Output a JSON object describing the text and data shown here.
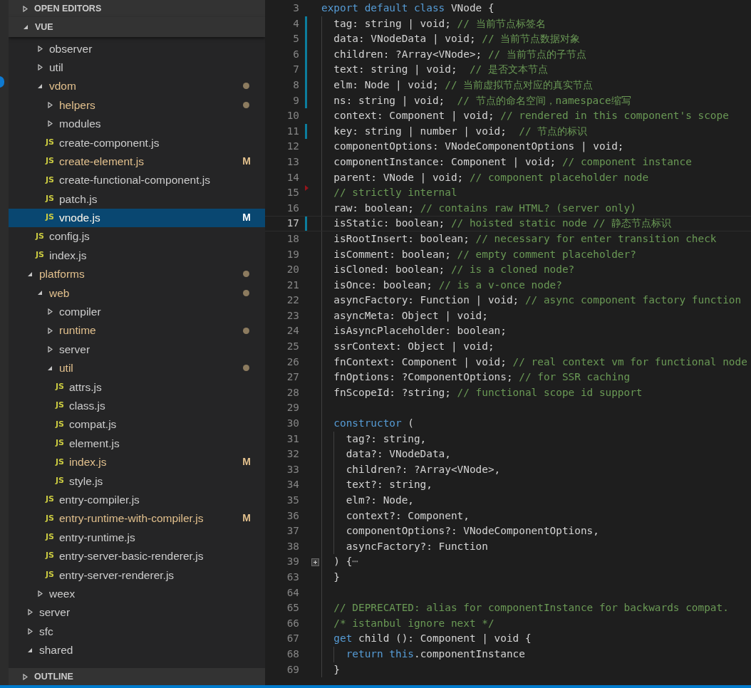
{
  "activity_bar": {
    "badge": true
  },
  "sidebar": {
    "sections": [
      {
        "title": "OPEN EDITORS",
        "expanded": false
      },
      {
        "title": "VUE",
        "expanded": true
      }
    ],
    "tree": [
      {
        "children": [
          {
            "label": "observer",
            "kind": "folder",
            "expanded": false,
            "modified": false,
            "selected": false
          },
          {
            "label": "util",
            "kind": "folder",
            "expanded": false,
            "modified": false,
            "selected": false
          },
          {
            "label": "vdom",
            "kind": "folder",
            "expanded": true,
            "modified": true,
            "selected": false,
            "children": [
              {
                "label": "helpers",
                "kind": "folder",
                "expanded": false,
                "modified": true,
                "selected": false
              },
              {
                "label": "modules",
                "kind": "folder",
                "expanded": false,
                "modified": false,
                "selected": false
              },
              {
                "label": "create-component.js",
                "kind": "file",
                "icon": "JS",
                "modified": false,
                "selected": false
              },
              {
                "label": "create-element.js",
                "kind": "file",
                "icon": "JS",
                "modified": true,
                "badge": "M",
                "selected": false
              },
              {
                "label": "create-functional-component.js",
                "kind": "file",
                "icon": "JS",
                "modified": false,
                "selected": false
              },
              {
                "label": "patch.js",
                "kind": "file",
                "icon": "JS",
                "modified": false,
                "selected": false
              },
              {
                "label": "vnode.js",
                "kind": "file",
                "icon": "JS",
                "modified": true,
                "badge": "M",
                "selected": true
              }
            ]
          },
          {
            "label": "config.js",
            "kind": "file",
            "icon": "JS",
            "modified": false,
            "selected": false
          },
          {
            "label": "index.js",
            "kind": "file",
            "icon": "JS",
            "modified": false,
            "selected": false
          }
        ]
      },
      {
        "label": "platforms",
        "kind": "folder",
        "expanded": true,
        "modified": true,
        "selected": false,
        "children": [
          {
            "label": "web",
            "kind": "folder",
            "expanded": true,
            "modified": true,
            "selected": false,
            "children": [
              {
                "label": "compiler",
                "kind": "folder",
                "expanded": false,
                "modified": false,
                "selected": false
              },
              {
                "label": "runtime",
                "kind": "folder",
                "expanded": false,
                "modified": true,
                "selected": false
              },
              {
                "label": "server",
                "kind": "folder",
                "expanded": false,
                "modified": false,
                "selected": false
              },
              {
                "label": "util",
                "kind": "folder",
                "expanded": true,
                "modified": true,
                "selected": false,
                "children": [
                  {
                    "label": "attrs.js",
                    "kind": "file",
                    "icon": "JS",
                    "modified": false,
                    "selected": false
                  },
                  {
                    "label": "class.js",
                    "kind": "file",
                    "icon": "JS",
                    "modified": false,
                    "selected": false
                  },
                  {
                    "label": "compat.js",
                    "kind": "file",
                    "icon": "JS",
                    "modified": false,
                    "selected": false
                  },
                  {
                    "label": "element.js",
                    "kind": "file",
                    "icon": "JS",
                    "modified": false,
                    "selected": false
                  },
                  {
                    "label": "index.js",
                    "kind": "file",
                    "icon": "JS",
                    "modified": true,
                    "badge": "M",
                    "selected": false
                  },
                  {
                    "label": "style.js",
                    "kind": "file",
                    "icon": "JS",
                    "modified": false,
                    "selected": false
                  }
                ]
              },
              {
                "label": "entry-compiler.js",
                "kind": "file",
                "icon": "JS",
                "modified": false,
                "selected": false
              },
              {
                "label": "entry-runtime-with-compiler.js",
                "kind": "file",
                "icon": "JS",
                "modified": true,
                "badge": "M",
                "selected": false
              },
              {
                "label": "entry-runtime.js",
                "kind": "file",
                "icon": "JS",
                "modified": false,
                "selected": false
              },
              {
                "label": "entry-server-basic-renderer.js",
                "kind": "file",
                "icon": "JS",
                "modified": false,
                "selected": false
              },
              {
                "label": "entry-server-renderer.js",
                "kind": "file",
                "icon": "JS",
                "modified": false,
                "selected": false
              }
            ]
          },
          {
            "label": "weex",
            "kind": "folder",
            "expanded": false,
            "modified": false,
            "selected": false
          }
        ]
      },
      {
        "label": "server",
        "kind": "folder",
        "expanded": false,
        "modified": false,
        "selected": false
      },
      {
        "label": "sfc",
        "kind": "folder",
        "expanded": false,
        "modified": false,
        "selected": false
      },
      {
        "label": "shared",
        "kind": "folder",
        "expanded": true,
        "modified": false,
        "selected": false
      }
    ],
    "bottom_sections": [
      {
        "title": "OUTLINE",
        "expanded": false
      }
    ]
  },
  "editor": {
    "lines": [
      {
        "n": "3",
        "parts": [
          {
            "kind": "keyword",
            "text": "export default class"
          },
          {
            "kind": "code",
            "text": " VNode {"
          }
        ]
      },
      {
        "n": "4",
        "changed": true,
        "parts": [
          {
            "kind": "code",
            "text": "  tag: string | void; "
          },
          {
            "kind": "comment",
            "text": "// 当前节点标签名"
          }
        ]
      },
      {
        "n": "5",
        "changed": true,
        "parts": [
          {
            "kind": "code",
            "text": "  data: VNodeData | void; "
          },
          {
            "kind": "comment",
            "text": "// 当前节点数据对象"
          }
        ]
      },
      {
        "n": "6",
        "changed": true,
        "parts": [
          {
            "kind": "code",
            "text": "  children: ?Array<VNode>; "
          },
          {
            "kind": "comment",
            "text": "// 当前节点的子节点"
          }
        ]
      },
      {
        "n": "7",
        "changed": true,
        "parts": [
          {
            "kind": "code",
            "text": "  text: string | void;  "
          },
          {
            "kind": "comment",
            "text": "// 是否文本节点"
          }
        ]
      },
      {
        "n": "8",
        "changed": true,
        "parts": [
          {
            "kind": "code",
            "text": "  elm: Node | void; "
          },
          {
            "kind": "comment",
            "text": "// 当前虚拟节点对应的真实节点"
          }
        ]
      },
      {
        "n": "9",
        "changed": true,
        "parts": [
          {
            "kind": "code",
            "text": "  ns: string | void;  "
          },
          {
            "kind": "comment",
            "text": "// 节点的命名空间，namespace缩写"
          }
        ]
      },
      {
        "n": "10",
        "parts": [
          {
            "kind": "code",
            "text": "  context: Component | void; "
          },
          {
            "kind": "comment",
            "text": "// rendered in this component's scope"
          }
        ]
      },
      {
        "n": "11",
        "changed": true,
        "parts": [
          {
            "kind": "code",
            "text": "  key: string | number | void;  "
          },
          {
            "kind": "comment",
            "text": "// 节点的标识"
          }
        ]
      },
      {
        "n": "12",
        "parts": [
          {
            "kind": "code",
            "text": "  componentOptions: VNodeComponentOptions | void;"
          }
        ]
      },
      {
        "n": "13",
        "parts": [
          {
            "kind": "code",
            "text": "  componentInstance: Component | void; "
          },
          {
            "kind": "comment",
            "text": "// component instance"
          }
        ]
      },
      {
        "n": "14",
        "parts": [
          {
            "kind": "code",
            "text": "  parent: VNode | void; "
          },
          {
            "kind": "comment",
            "text": "// component placeholder node"
          }
        ]
      },
      {
        "n": "15",
        "deleted": true,
        "parts": [
          {
            "kind": "comment",
            "text": "  // strictly internal"
          }
        ]
      },
      {
        "n": "16",
        "parts": [
          {
            "kind": "code",
            "text": "  raw: boolean; "
          },
          {
            "kind": "comment",
            "text": "// contains raw HTML? (server only)"
          }
        ]
      },
      {
        "n": "17",
        "changed": true,
        "current": true,
        "parts": [
          {
            "kind": "code",
            "text": "  isStatic: boolean; "
          },
          {
            "kind": "comment",
            "text": "// hoisted static node // 静态节点标识"
          }
        ]
      },
      {
        "n": "18",
        "parts": [
          {
            "kind": "code",
            "text": "  isRootInsert: boolean; "
          },
          {
            "kind": "comment",
            "text": "// necessary for enter transition check"
          }
        ]
      },
      {
        "n": "19",
        "parts": [
          {
            "kind": "code",
            "text": "  isComment: boolean; "
          },
          {
            "kind": "comment",
            "text": "// empty comment placeholder?"
          }
        ]
      },
      {
        "n": "20",
        "parts": [
          {
            "kind": "code",
            "text": "  isCloned: boolean; "
          },
          {
            "kind": "comment",
            "text": "// is a cloned node?"
          }
        ]
      },
      {
        "n": "21",
        "parts": [
          {
            "kind": "code",
            "text": "  isOnce: boolean; "
          },
          {
            "kind": "comment",
            "text": "// is a v-once node?"
          }
        ]
      },
      {
        "n": "22",
        "parts": [
          {
            "kind": "code",
            "text": "  asyncFactory: Function | void; "
          },
          {
            "kind": "comment",
            "text": "// async component factory function"
          }
        ]
      },
      {
        "n": "23",
        "parts": [
          {
            "kind": "code",
            "text": "  asyncMeta: Object | void;"
          }
        ]
      },
      {
        "n": "24",
        "parts": [
          {
            "kind": "code",
            "text": "  isAsyncPlaceholder: boolean;"
          }
        ]
      },
      {
        "n": "25",
        "parts": [
          {
            "kind": "code",
            "text": "  ssrContext: Object | void;"
          }
        ]
      },
      {
        "n": "26",
        "parts": [
          {
            "kind": "code",
            "text": "  fnContext: Component | void; "
          },
          {
            "kind": "comment",
            "text": "// real context vm for functional node"
          }
        ]
      },
      {
        "n": "27",
        "parts": [
          {
            "kind": "code",
            "text": "  fnOptions: ?ComponentOptions; "
          },
          {
            "kind": "comment",
            "text": "// for SSR caching"
          }
        ]
      },
      {
        "n": "28",
        "parts": [
          {
            "kind": "code",
            "text": "  fnScopeId: ?string; "
          },
          {
            "kind": "comment",
            "text": "// functional scope id support"
          }
        ]
      },
      {
        "n": "29"
      },
      {
        "n": "30",
        "parts": [
          {
            "kind": "keyword",
            "text": "  constructor"
          },
          {
            "kind": "code",
            "text": " ("
          }
        ]
      },
      {
        "n": "31",
        "parts": [
          {
            "kind": "code",
            "text": "    tag?: string,"
          }
        ]
      },
      {
        "n": "32",
        "parts": [
          {
            "kind": "code",
            "text": "    data?: VNodeData,"
          }
        ]
      },
      {
        "n": "33",
        "parts": [
          {
            "kind": "code",
            "text": "    children?: ?Array<VNode>,"
          }
        ]
      },
      {
        "n": "34",
        "parts": [
          {
            "kind": "code",
            "text": "    text?: string,"
          }
        ]
      },
      {
        "n": "35",
        "parts": [
          {
            "kind": "code",
            "text": "    elm?: Node,"
          }
        ]
      },
      {
        "n": "36",
        "parts": [
          {
            "kind": "code",
            "text": "    context?: Component,"
          }
        ]
      },
      {
        "n": "37",
        "parts": [
          {
            "kind": "code",
            "text": "    componentOptions?: VNodeComponentOptions,"
          }
        ]
      },
      {
        "n": "38",
        "parts": [
          {
            "kind": "code",
            "text": "    asyncFactory?: Function"
          }
        ]
      },
      {
        "n": "39",
        "folded": true,
        "parts": [
          {
            "kind": "code",
            "text": "  ) {"
          },
          {
            "kind": "fold",
            "text": "⋯"
          }
        ]
      },
      {
        "n": "63",
        "parts": [
          {
            "kind": "code",
            "text": "  }"
          }
        ]
      },
      {
        "n": "64"
      },
      {
        "n": "65",
        "parts": [
          {
            "kind": "comment",
            "text": "  // DEPRECATED: alias for componentInstance for backwards compat."
          }
        ]
      },
      {
        "n": "66",
        "parts": [
          {
            "kind": "comment",
            "text": "  /* istanbul ignore next */"
          }
        ]
      },
      {
        "n": "67",
        "parts": [
          {
            "kind": "keyword",
            "text": "  get"
          },
          {
            "kind": "code",
            "text": " child (): Component | void {"
          }
        ]
      },
      {
        "n": "68",
        "parts": [
          {
            "kind": "keyword",
            "text": "    return this"
          },
          {
            "kind": "code",
            "text": ".componentInstance"
          }
        ]
      },
      {
        "n": "69",
        "parts": [
          {
            "kind": "code",
            "text": "  }"
          }
        ]
      }
    ]
  }
}
